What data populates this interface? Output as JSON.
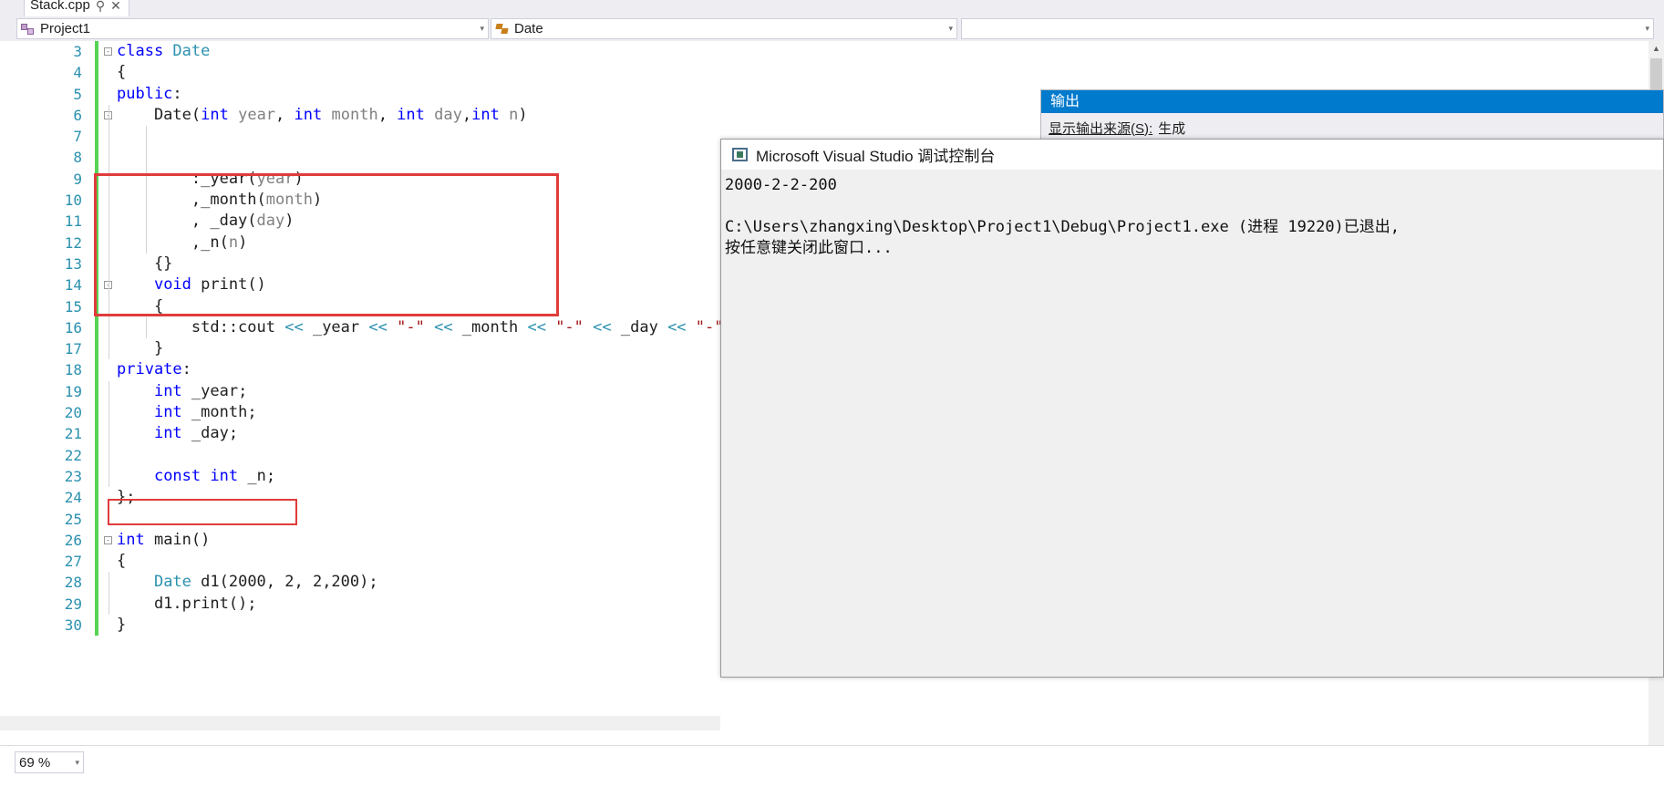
{
  "window": {
    "tab": {
      "label": "Stack.cpp",
      "pin_glyph": "⚲",
      "close_glyph": "✕"
    }
  },
  "navbar": {
    "project_combo": {
      "value": "Project1",
      "icon": "project-icon",
      "arrow": "▾"
    },
    "member_combo": {
      "value": "Date",
      "icon": "class-icon",
      "arrow": "▾"
    },
    "third_combo": {
      "value": "",
      "arrow": "▾"
    }
  },
  "editor": {
    "zoom_level": "69 %",
    "track_changes_glyph": "⇕",
    "scroll_up_glyph": "▲",
    "lines": [
      {
        "num": "3",
        "indent": 0,
        "glyph": "-",
        "tokens": [
          {
            "t": "class ",
            "c": "kw"
          },
          {
            "t": "Date",
            "c": "ty"
          }
        ]
      },
      {
        "num": "4",
        "indent": 0,
        "glyph": "",
        "tokens": [
          {
            "t": "{",
            "c": ""
          }
        ]
      },
      {
        "num": "5",
        "indent": 0,
        "glyph": "",
        "tokens": [
          {
            "t": "public",
            "c": "kw"
          },
          {
            "t": ":",
            "c": ""
          }
        ]
      },
      {
        "num": "6",
        "indent": 1,
        "glyph": "-",
        "tokens": [
          {
            "t": "    Date(",
            "c": ""
          },
          {
            "t": "int",
            "c": "kw"
          },
          {
            "t": " ",
            "c": ""
          },
          {
            "t": "year",
            "c": "pm"
          },
          {
            "t": ", ",
            "c": ""
          },
          {
            "t": "int",
            "c": "kw"
          },
          {
            "t": " ",
            "c": ""
          },
          {
            "t": "month",
            "c": "pm"
          },
          {
            "t": ", ",
            "c": ""
          },
          {
            "t": "int",
            "c": "kw"
          },
          {
            "t": " ",
            "c": ""
          },
          {
            "t": "day",
            "c": "pm"
          },
          {
            "t": ",",
            "c": ""
          },
          {
            "t": "int",
            "c": "kw"
          },
          {
            "t": " ",
            "c": ""
          },
          {
            "t": "n",
            "c": "pm"
          },
          {
            "t": ")",
            "c": ""
          }
        ]
      },
      {
        "num": "7",
        "indent": 2,
        "glyph": "",
        "tokens": []
      },
      {
        "num": "8",
        "indent": 2,
        "glyph": "",
        "tokens": []
      },
      {
        "num": "9",
        "indent": 2,
        "glyph": "",
        "tokens": [
          {
            "t": "        :_year(",
            "c": ""
          },
          {
            "t": "year",
            "c": "pm"
          },
          {
            "t": ")",
            "c": ""
          }
        ]
      },
      {
        "num": "10",
        "indent": 2,
        "glyph": "",
        "tokens": [
          {
            "t": "        ,_month(",
            "c": ""
          },
          {
            "t": "month",
            "c": "pm"
          },
          {
            "t": ")",
            "c": ""
          }
        ]
      },
      {
        "num": "11",
        "indent": 2,
        "glyph": "",
        "tokens": [
          {
            "t": "        , _day(",
            "c": ""
          },
          {
            "t": "day",
            "c": "pm"
          },
          {
            "t": ")",
            "c": ""
          }
        ]
      },
      {
        "num": "12",
        "indent": 2,
        "glyph": "",
        "tokens": [
          {
            "t": "        ,_n(",
            "c": ""
          },
          {
            "t": "n",
            "c": "pm"
          },
          {
            "t": ")",
            "c": ""
          }
        ]
      },
      {
        "num": "13",
        "indent": 1,
        "glyph": "",
        "tokens": [
          {
            "t": "    {}",
            "c": ""
          }
        ]
      },
      {
        "num": "14",
        "indent": 1,
        "glyph": "-",
        "tokens": [
          {
            "t": "    ",
            "c": ""
          },
          {
            "t": "void",
            "c": "kw"
          },
          {
            "t": " print()",
            "c": ""
          }
        ]
      },
      {
        "num": "15",
        "indent": 1,
        "glyph": "",
        "tokens": [
          {
            "t": "    {",
            "c": ""
          }
        ]
      },
      {
        "num": "16",
        "indent": 2,
        "glyph": "",
        "tokens": [
          {
            "t": "        std::cout ",
            "c": ""
          },
          {
            "t": "<<",
            "c": "op"
          },
          {
            "t": " _year ",
            "c": ""
          },
          {
            "t": "<<",
            "c": "op"
          },
          {
            "t": " ",
            "c": ""
          },
          {
            "t": "\"-\"",
            "c": "st"
          },
          {
            "t": " ",
            "c": ""
          },
          {
            "t": "<<",
            "c": "op"
          },
          {
            "t": " _month ",
            "c": ""
          },
          {
            "t": "<<",
            "c": "op"
          },
          {
            "t": " ",
            "c": ""
          },
          {
            "t": "\"-\"",
            "c": "st"
          },
          {
            "t": " ",
            "c": ""
          },
          {
            "t": "<<",
            "c": "op"
          },
          {
            "t": " _day ",
            "c": ""
          },
          {
            "t": "<<",
            "c": "op"
          },
          {
            "t": " ",
            "c": ""
          },
          {
            "t": "\"-\"",
            "c": "st"
          }
        ]
      },
      {
        "num": "17",
        "indent": 1,
        "glyph": "",
        "tokens": [
          {
            "t": "    }",
            "c": ""
          }
        ]
      },
      {
        "num": "18",
        "indent": 0,
        "glyph": "",
        "tokens": [
          {
            "t": "private",
            "c": "kw"
          },
          {
            "t": ":",
            "c": ""
          }
        ]
      },
      {
        "num": "19",
        "indent": 1,
        "glyph": "",
        "tokens": [
          {
            "t": "    ",
            "c": ""
          },
          {
            "t": "int",
            "c": "kw"
          },
          {
            "t": " _year;",
            "c": ""
          }
        ]
      },
      {
        "num": "20",
        "indent": 1,
        "glyph": "",
        "tokens": [
          {
            "t": "    ",
            "c": ""
          },
          {
            "t": "int",
            "c": "kw"
          },
          {
            "t": " _month;",
            "c": ""
          }
        ]
      },
      {
        "num": "21",
        "indent": 1,
        "glyph": "",
        "tokens": [
          {
            "t": "    ",
            "c": ""
          },
          {
            "t": "int",
            "c": "kw"
          },
          {
            "t": " _day;",
            "c": ""
          }
        ]
      },
      {
        "num": "22",
        "indent": 1,
        "glyph": "",
        "tokens": []
      },
      {
        "num": "23",
        "indent": 1,
        "glyph": "",
        "tokens": [
          {
            "t": "    ",
            "c": ""
          },
          {
            "t": "const",
            "c": "kw"
          },
          {
            "t": " ",
            "c": ""
          },
          {
            "t": "int",
            "c": "kw"
          },
          {
            "t": " _n;",
            "c": ""
          }
        ]
      },
      {
        "num": "24",
        "indent": 0,
        "glyph": "",
        "tokens": [
          {
            "t": "};",
            "c": ""
          }
        ]
      },
      {
        "num": "25",
        "indent": 0,
        "glyph": "",
        "tokens": []
      },
      {
        "num": "26",
        "indent": 0,
        "glyph": "-",
        "tokens": [
          {
            "t": "int",
            "c": "kw"
          },
          {
            "t": " main()",
            "c": ""
          }
        ]
      },
      {
        "num": "27",
        "indent": 0,
        "glyph": "",
        "tokens": [
          {
            "t": "{",
            "c": ""
          }
        ]
      },
      {
        "num": "28",
        "indent": 1,
        "glyph": "",
        "tokens": [
          {
            "t": "    ",
            "c": ""
          },
          {
            "t": "Date",
            "c": "ty"
          },
          {
            "t": " d1(2000, 2, 2,200);",
            "c": ""
          }
        ]
      },
      {
        "num": "29",
        "indent": 1,
        "glyph": "",
        "tokens": [
          {
            "t": "    d1.print();",
            "c": ""
          }
        ]
      },
      {
        "num": "30",
        "indent": 0,
        "glyph": "",
        "tokens": [
          {
            "t": "}",
            "c": ""
          }
        ]
      }
    ]
  },
  "annotations": {
    "box1_label": "constructor-initializer-list-highlight",
    "box2_label": "const-member-highlight",
    "color": "#e03b3b"
  },
  "output_pane": {
    "title": "输出",
    "source_label": "显示输出来源(S):",
    "source_value": "生成"
  },
  "console": {
    "title": "Microsoft Visual Studio 调试控制台",
    "icon": "console-icon",
    "lines": [
      "2000-2-2-200",
      "",
      "C:\\Users\\zhangxing\\Desktop\\Project1\\Debug\\Project1.exe (进程 19220)已退出,",
      "按任意键关闭此窗口..."
    ]
  },
  "colors": {
    "accent": "#007acc",
    "annotation_red": "#e03b3b",
    "keyword_blue": "#0000ff",
    "type_teal": "#2b91af",
    "string_red": "#a31515",
    "param_gray": "#808080",
    "changebar_green": "#57d354",
    "chrome_gray": "#eeeef2"
  }
}
